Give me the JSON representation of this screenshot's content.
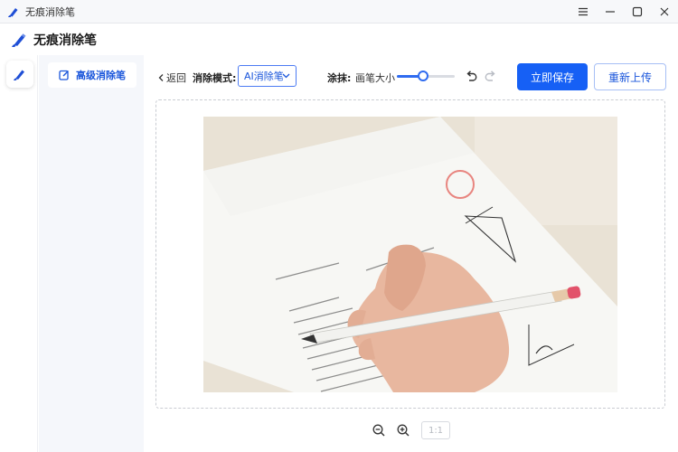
{
  "window": {
    "title": "无痕消除笔",
    "controls": [
      "menu-icon",
      "minimize-icon",
      "maximize-icon",
      "close-icon"
    ]
  },
  "app": {
    "name": "无痕消除笔",
    "logo_icon": "eraser-pen-icon",
    "accent_color": "#1660f5"
  },
  "rail": {
    "tool_icon": "eraser-pen-icon"
  },
  "sidebar": {
    "items": [
      {
        "label": "高级消除笔",
        "icon": "edit-icon",
        "active": true
      }
    ]
  },
  "toolbar": {
    "back_label": "返回",
    "mode_label": "消除模式:",
    "mode_value": "AI消除笔",
    "smear_label": "涂抹:",
    "brush_label": "画笔大小",
    "brush_size_fraction": 0.45,
    "undo_icon": "undo-icon",
    "redo_icon": "redo-icon",
    "save_label": "立即保存",
    "reupload_label": "重新上传"
  },
  "zoom": {
    "zoom_out_icon": "zoom-out-icon",
    "zoom_in_icon": "zoom-in-icon",
    "ratio_label": "1:1"
  }
}
